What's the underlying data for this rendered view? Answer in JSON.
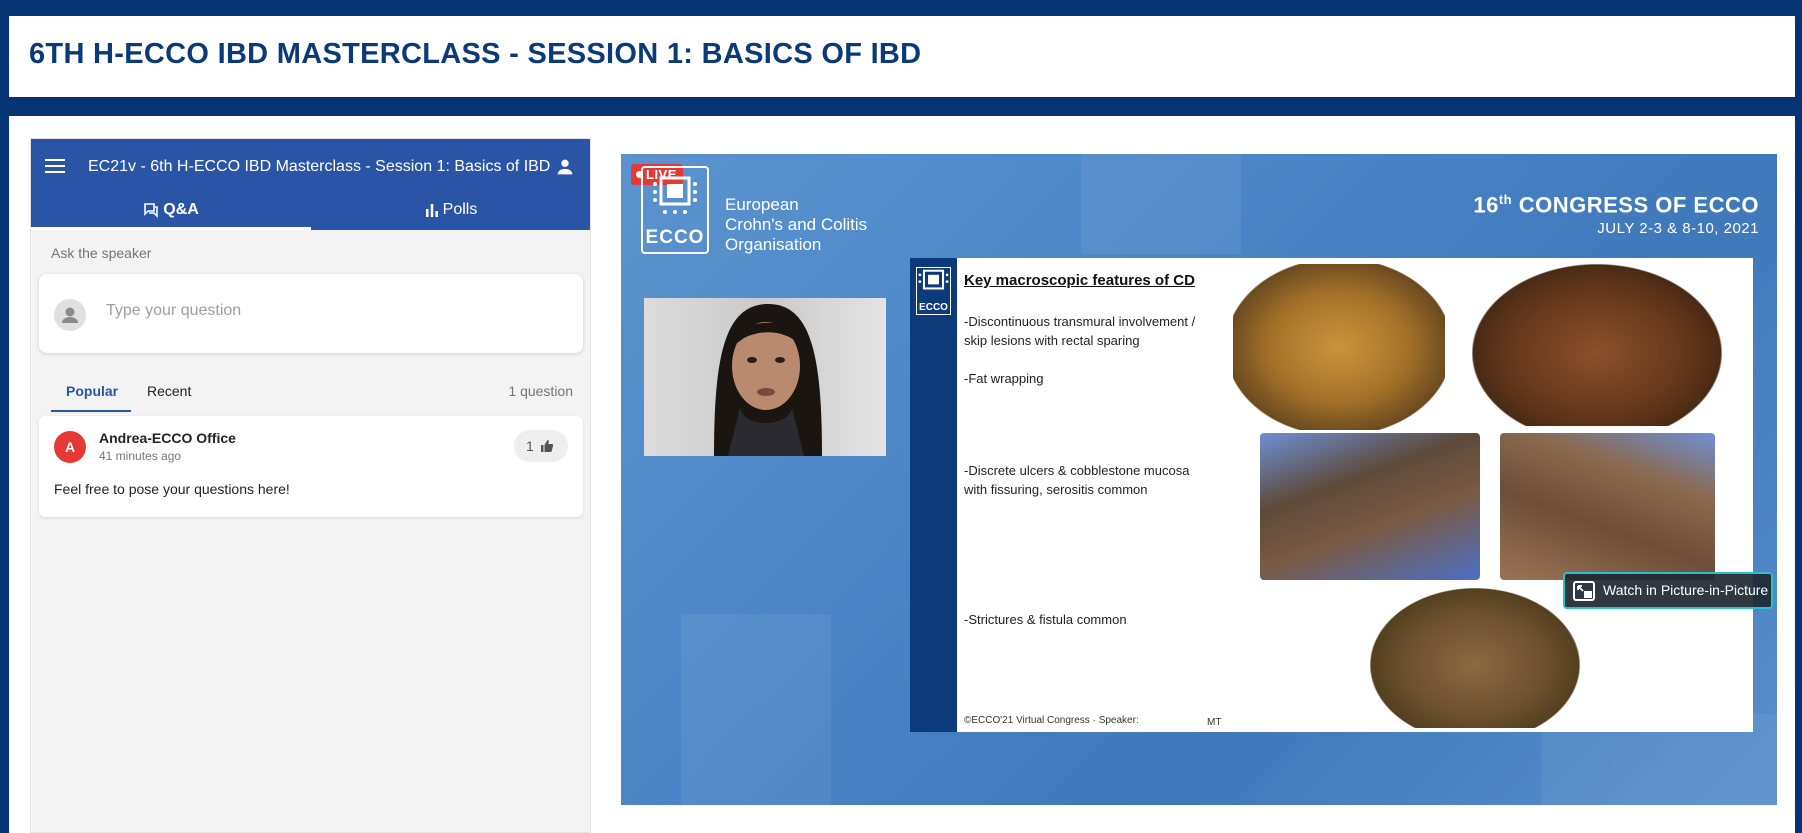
{
  "page": {
    "title": "6TH H-ECCO IBD MASTERCLASS - SESSION 1: BASICS OF IBD"
  },
  "panel": {
    "event_title": "EC21v - 6th H-ECCO IBD Masterclass - Session 1: Basics of IBD",
    "tabs": [
      {
        "label": "Q&A",
        "icon": "speech-bubbles-icon",
        "active": true
      },
      {
        "label": "Polls",
        "icon": "bar-chart-icon",
        "active": false
      }
    ],
    "ask_label": "Ask the speaker",
    "ask_placeholder": "Type your question",
    "sort_tabs": [
      {
        "label": "Popular",
        "active": true
      },
      {
        "label": "Recent",
        "active": false
      }
    ],
    "question_count": "1 question",
    "questions": [
      {
        "avatar_letter": "A",
        "author": "Andrea-ECCO Office",
        "time": "41 minutes ago",
        "likes": "1",
        "text": "Feel free to pose your questions here!"
      }
    ],
    "colors": {
      "header": "#2a55a6",
      "avatar": "#e53935"
    }
  },
  "video": {
    "live_label": "LIVE",
    "org_logo_text": "ECCO",
    "org_name_lines": [
      "European",
      "Crohn's and Colitis",
      "Organisation"
    ],
    "congress_number": "16",
    "congress_suffix": "th",
    "congress_title": "CONGRESS OF ECCO",
    "congress_dates": "JULY 2-3 & 8-10, 2021",
    "slide": {
      "logo_text": "ECCO",
      "heading": "Key macroscopic features of CD",
      "points": [
        "-Discontinuous transmural involvement /",
        "skip lesions with rectal sparing",
        "-Fat wrapping",
        "-Discrete ulcers & cobblestone mucosa",
        " with fissuring, serositis common",
        "-Strictures & fistula common"
      ],
      "footer": "©ECCO'21 Virtual Congress  ·  Speaker:",
      "footer_speaker": "MT"
    },
    "pip_label": "Watch in Picture-in-Picture"
  }
}
